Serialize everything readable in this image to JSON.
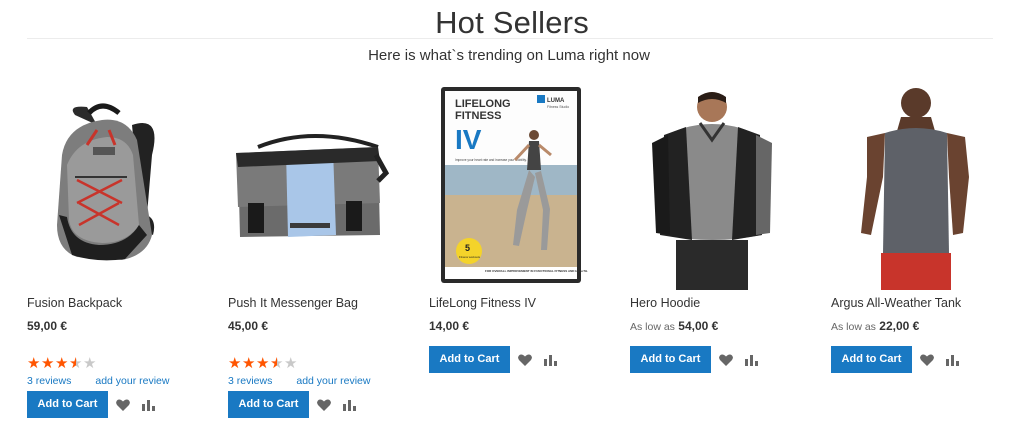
{
  "section": {
    "title": "Hot Sellers",
    "subtitle": "Here is what`s trending on Luma right now"
  },
  "products": [
    {
      "name": "Fusion Backpack",
      "price": "59,00 €",
      "rating_percent": 67,
      "reviews": "3  reviews",
      "add_review": "add your review",
      "add_to_cart": "Add to Cart"
    },
    {
      "name": "Push It Messenger Bag",
      "price": "45,00 €",
      "rating_percent": 67,
      "reviews": "3  reviews",
      "add_review": "add your review",
      "add_to_cart": "Add to Cart"
    },
    {
      "name": "LifeLong Fitness IV",
      "price": "14,00 €",
      "add_to_cart": "Add to Cart",
      "dvd": {
        "title_line1": "LIFELONG",
        "title_line2": "FITNESS",
        "title_line3": "IV",
        "brand": "LUMA",
        "brand_sub": "Fitness Studio",
        "tagline": "Improve your heart rate and increase your mobility.",
        "badge_num": "5",
        "badge_text": "Fitness workouts",
        "footer": "FOR OVERALL IMPROVEMENT IN FUNCTIONAL FITNESS AND HEALTH."
      }
    },
    {
      "name": "Hero Hoodie",
      "as_low_as": "As low as",
      "price": "54,00 €",
      "add_to_cart": "Add to Cart"
    },
    {
      "name": "Argus All-Weather Tank",
      "as_low_as": "As low as",
      "price": "22,00 €",
      "add_to_cart": "Add to Cart"
    }
  ],
  "icons": {
    "wishlist": "heart-icon",
    "compare": "bar-chart-icon",
    "star": "star-icon"
  },
  "colors": {
    "primary": "#1979c3",
    "star": "#ff5501",
    "star_off": "#c9c9c9",
    "text": "#333333"
  }
}
